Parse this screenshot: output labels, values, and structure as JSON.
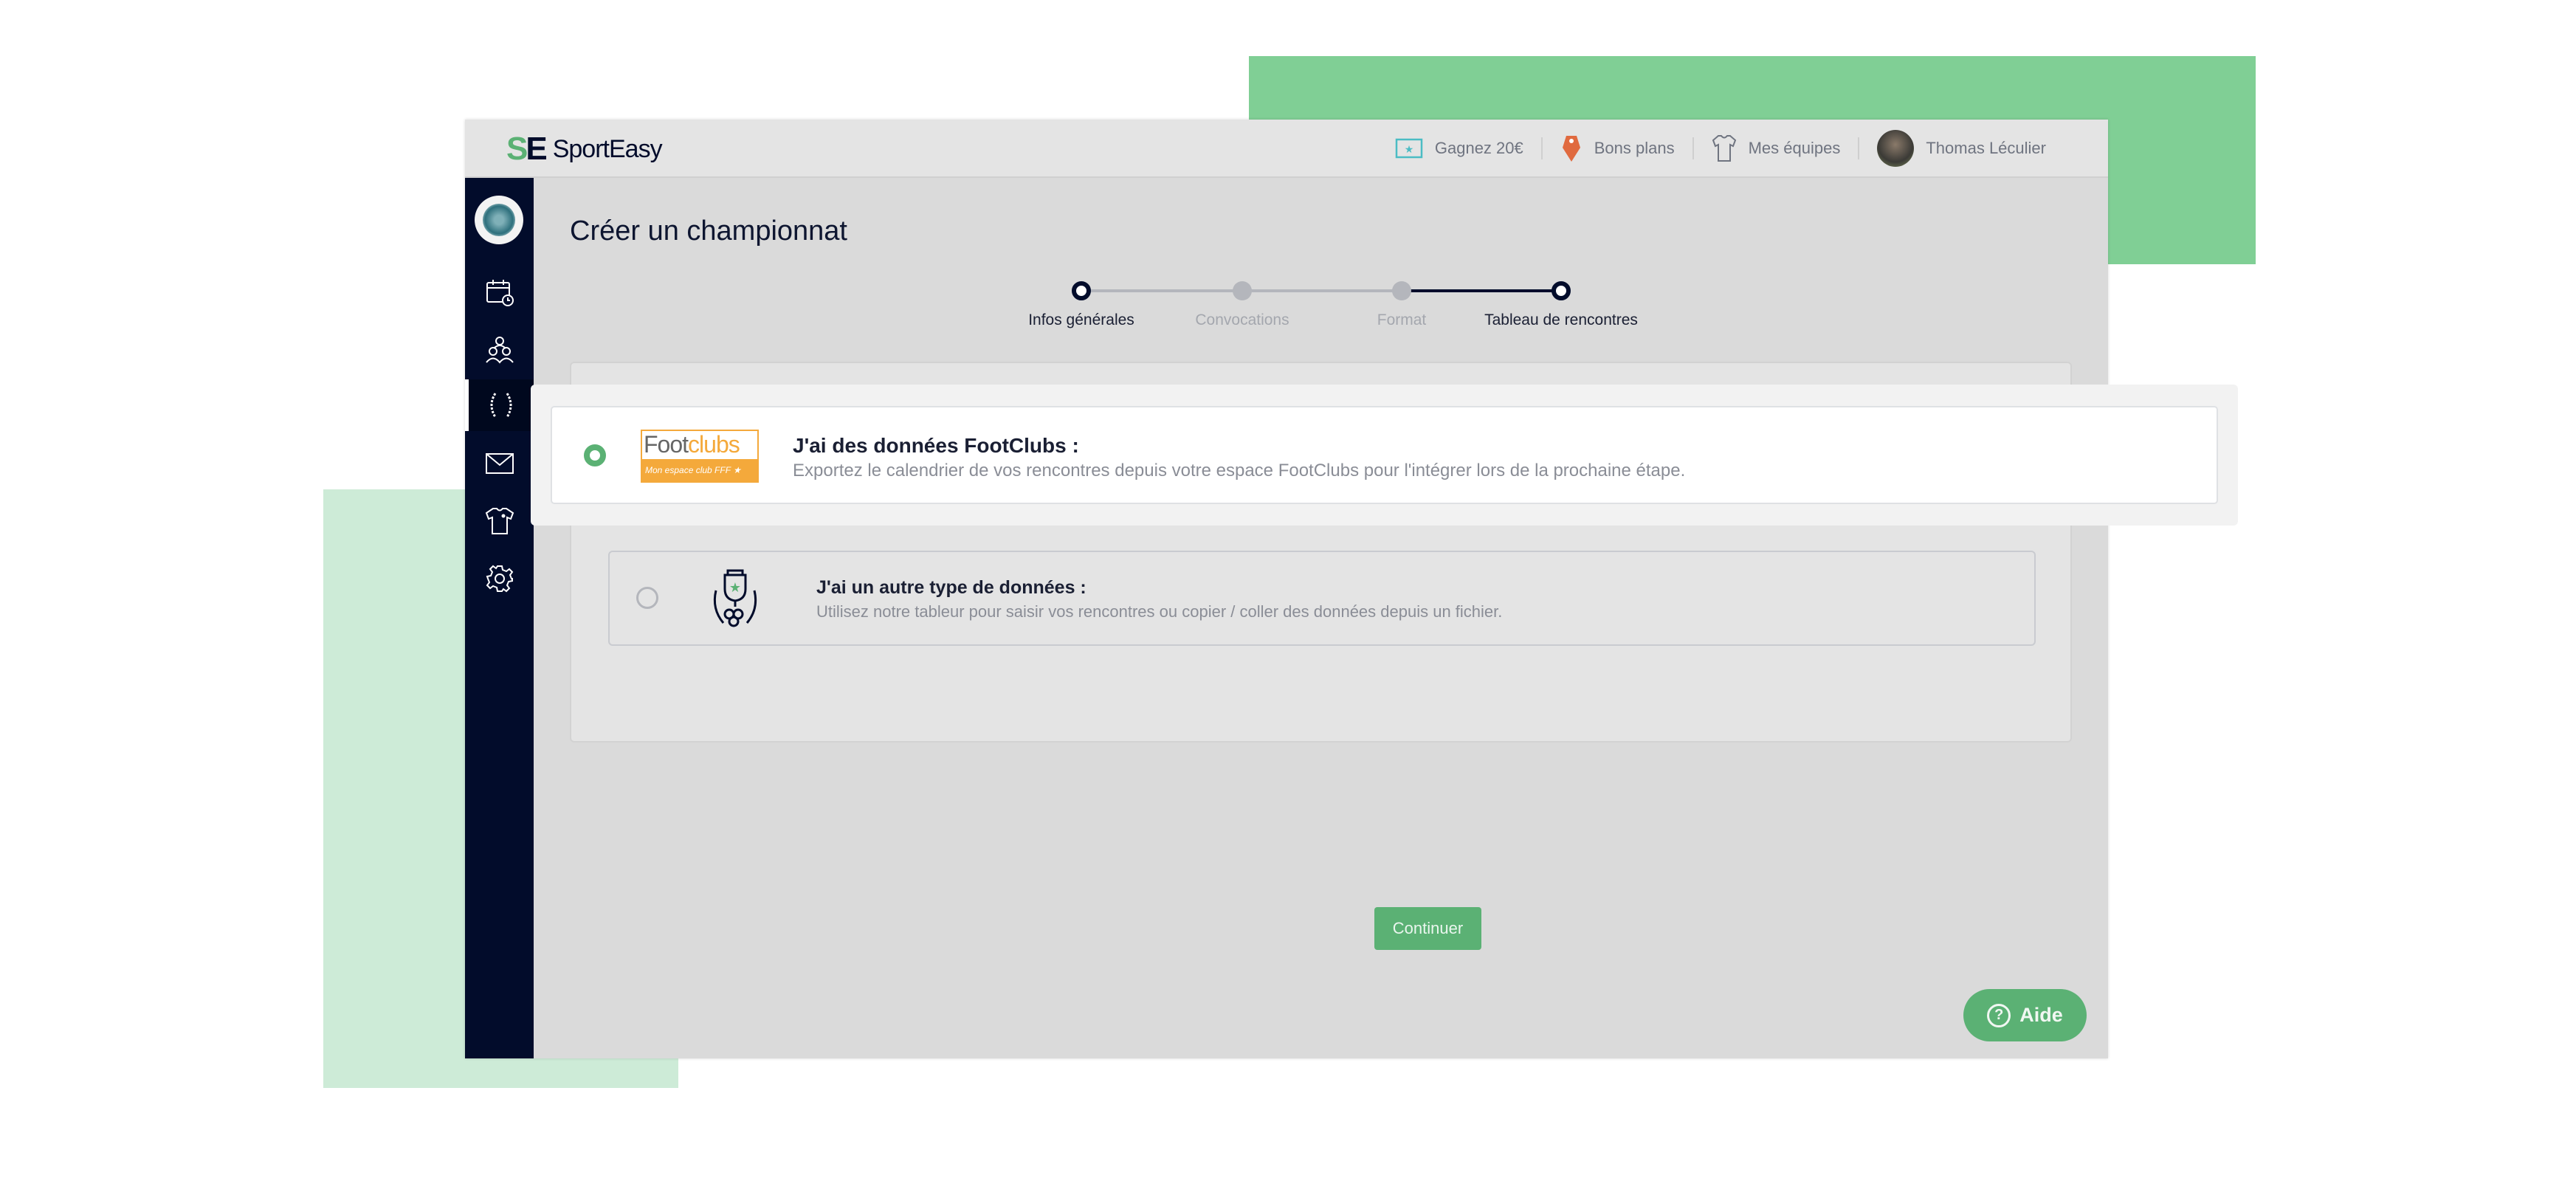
{
  "header": {
    "brand": "SportEasy",
    "logo_mark": "SE",
    "items": [
      {
        "icon": "ticket-icon",
        "label": "Gagnez 20€"
      },
      {
        "icon": "price-tag-icon",
        "label": "Bons plans"
      },
      {
        "icon": "jersey-icon",
        "label": "Mes équipes"
      },
      {
        "icon": "avatar",
        "label": "Thomas Léculier"
      }
    ]
  },
  "sidebar": {
    "items": [
      {
        "icon": "calendar-clock-icon"
      },
      {
        "icon": "people-icon"
      },
      {
        "icon": "laurel-icon",
        "active": true
      },
      {
        "icon": "envelope-icon"
      },
      {
        "icon": "jersey-icon"
      },
      {
        "icon": "gear-icon"
      }
    ]
  },
  "page": {
    "title": "Créer un championnat",
    "steps": [
      {
        "label": "Infos générales",
        "state": "done"
      },
      {
        "label": "Convocations",
        "state": "skipped"
      },
      {
        "label": "Format",
        "state": "done"
      },
      {
        "label": "Tableau de rencontres",
        "state": "current"
      }
    ],
    "options": [
      {
        "logo_top_a": "Foot",
        "logo_top_b": "clubs",
        "logo_bottom": "Mon espace club FFF ★",
        "title": "J'ai des données FootClubs :",
        "description": "Exportez le calendrier de vos rencontres depuis votre espace FootClubs pour l'intégrer lors de la prochaine étape.",
        "selected": true
      },
      {
        "icon": "trophy-icon",
        "title": "J'ai un autre type de données :",
        "description": "Utilisez notre tableur pour saisir vos rencontres ou copier / coller des données depuis un fichier.",
        "selected": false
      }
    ],
    "continue_label": "Continuer"
  },
  "help": {
    "label": "Aide",
    "icon": "question-circle-icon"
  },
  "colors": {
    "accent": "#5bb174",
    "sidebar": "#020c2b",
    "footclubs": "#f4a93b",
    "deco_green": "#80cf95",
    "deco_light": "#cdebd7"
  }
}
